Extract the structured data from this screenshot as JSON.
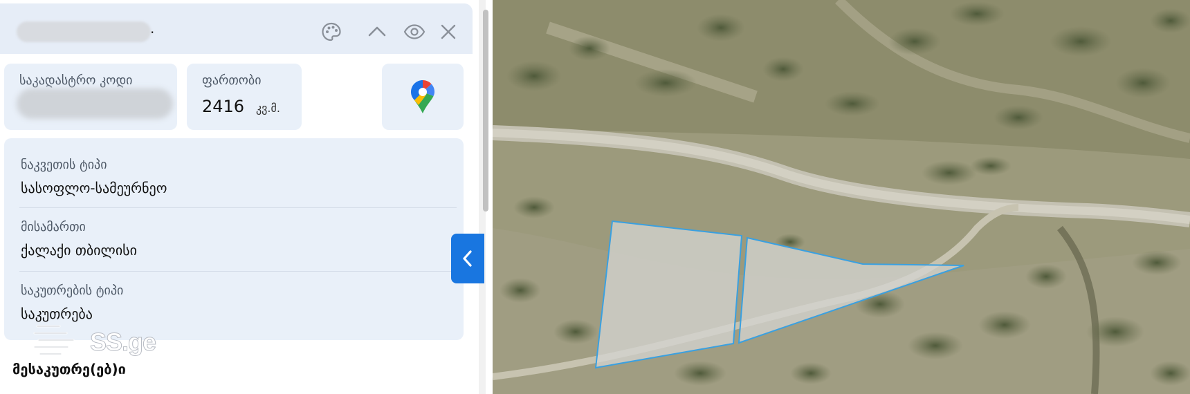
{
  "header": {
    "title_suffix": ".",
    "icons": [
      "palette-icon",
      "chevron-up-icon",
      "eye-icon",
      "close-icon"
    ]
  },
  "cadastral": {
    "label": "საკადასტრო კოდი"
  },
  "area": {
    "label": "ფართობი",
    "value": "2416",
    "unit": "კვ.მ."
  },
  "details": [
    {
      "label": "ნაკვეთის ტიპი",
      "value": "სასოფლო-სამეურნეო"
    },
    {
      "label": "მისამართი",
      "value": "ქალაქი თბილისი"
    },
    {
      "label": "საკუთრების ტიპი",
      "value": "საკუთრება"
    }
  ],
  "owners_heading": "მესაკუთრე(ებ)ი",
  "watermark": "SS.ge",
  "colors": {
    "accent": "#1976e0",
    "card_bg": "#e9f0f9",
    "parcel_outline": "#3aa0e0"
  }
}
